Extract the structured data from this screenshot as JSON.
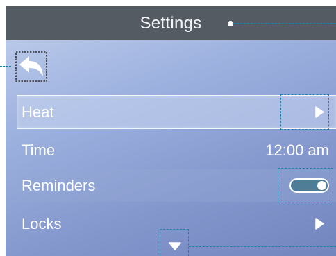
{
  "header": {
    "title": "Settings"
  },
  "navigation": {
    "back_icon": "back-arrow-icon"
  },
  "settings_list": {
    "rows": [
      {
        "label": "Heat",
        "control": "chevron-right-icon",
        "highlighted": true
      },
      {
        "label": "Time",
        "value": "12:00 am"
      },
      {
        "label": "Reminders",
        "control": "toggle",
        "toggle_on": true
      },
      {
        "label": "Locks",
        "control": "chevron-right-icon"
      }
    ]
  },
  "scroll": {
    "icon": "chevron-down-icon"
  },
  "colors": {
    "header_background": "#545b63",
    "header_text": "#f2f4f7",
    "background_top": "#c3d1ec",
    "background_bottom": "#7285bd",
    "row_text": "#ffffff",
    "toggle_track": "#4f7c97",
    "callout_annotation": "#1f7fa8",
    "back_button_focus_outline": "#333333"
  }
}
